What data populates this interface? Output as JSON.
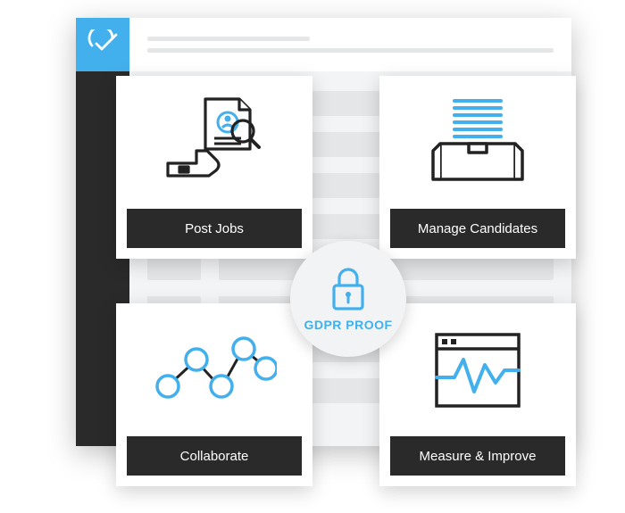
{
  "cards": {
    "post_jobs": {
      "label": "Post Jobs"
    },
    "manage_candidates": {
      "label": "Manage Candidates"
    },
    "collaborate": {
      "label": "Collaborate"
    },
    "measure_improve": {
      "label": "Measure & Improve"
    }
  },
  "badge": {
    "label": "GDPR PROOF"
  },
  "icons": {
    "logo": "checkmark-circle",
    "post_jobs": "hand-resume-magnifier",
    "manage_candidates": "inbox-stack",
    "collaborate": "network-graph",
    "measure_improve": "browser-pulse",
    "badge": "padlock"
  },
  "colors": {
    "accent": "#42b0ed",
    "dark": "#2a2a2a",
    "panel": "#f3f4f6"
  }
}
